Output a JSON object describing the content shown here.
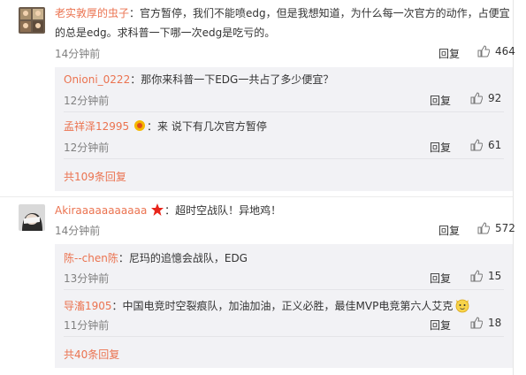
{
  "comments": [
    {
      "author": "老实敦厚的虫子",
      "line1": "：官方暂停，我们不能喷edg，但是我想知道，为什么每一次官方的动作，占便宜",
      "line2": "的总是edg。求科普一下哪一次edg是吃亏的。",
      "time": "14分钟前",
      "reply": "回复",
      "likes": "464",
      "replies": [
        {
          "author": "Onioni_0222",
          "text": "：那你来科普一下EDG一共占了多少便宜？",
          "time": "12分钟前",
          "reply": "回复",
          "likes": "92"
        },
        {
          "author": "孟祥泽12995",
          "text": "：来 说下有几次官方暂停",
          "time": "12分钟前",
          "reply": "回复",
          "likes": "61",
          "badge": "vip-badge"
        }
      ],
      "more": "共109条回复"
    },
    {
      "author": "Akiraaaaaaaaaaa",
      "text": "：超时空战队！异地鸡！",
      "time": "14分钟前",
      "reply": "回复",
      "likes": "572",
      "badge": "star-icon",
      "replies": [
        {
          "author": "陈--chen陈",
          "text": "：尼玛的追憶会战队，EDG",
          "time": "13分钟前",
          "reply": "回复",
          "likes": "15"
        },
        {
          "author": "导滀1905",
          "text": "：中国电竞时空裂痕队，加油加油，正义必胜，最佳MVP电竞第六人艾克",
          "time": "11分钟前",
          "reply": "回复",
          "likes": "18",
          "emoji": "cat-emoji"
        }
      ],
      "more": "共40条回复"
    }
  ],
  "colors": {
    "author": "#eb7350",
    "time": "#808080",
    "subbox": "#f2f2f5"
  }
}
